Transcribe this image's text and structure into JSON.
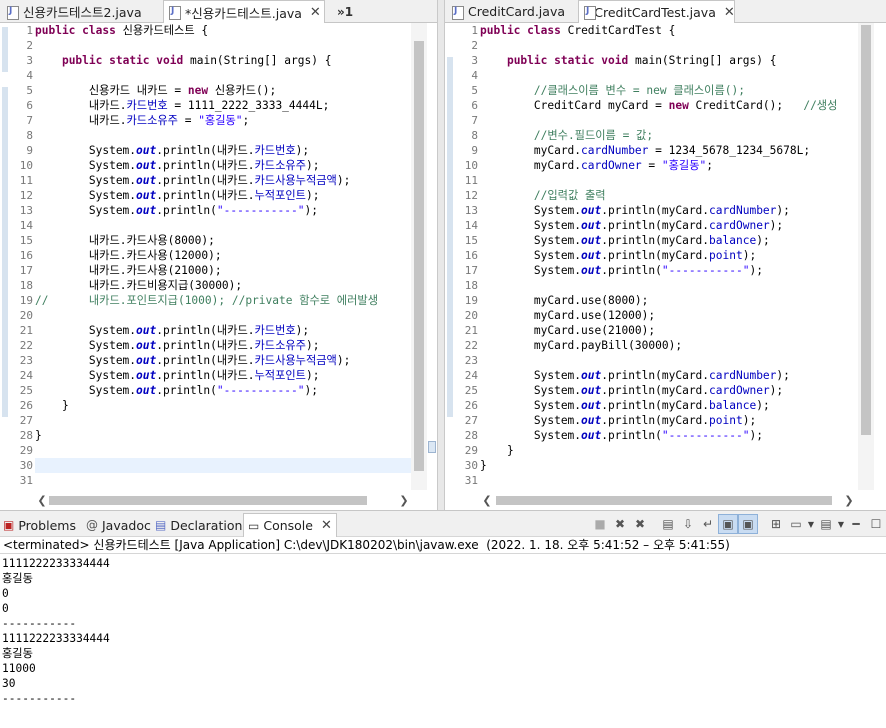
{
  "left_editor": {
    "tabs": [
      {
        "label": "신용카드테스트2.java",
        "active": false
      },
      {
        "label": "*신용카드테스트.java",
        "active": true
      },
      {
        "label": "»1",
        "overflow": true
      }
    ],
    "line_numbers": [
      "1",
      "2",
      "3",
      "4",
      "5",
      "6",
      "7",
      "8",
      "9",
      "10",
      "11",
      "12",
      "13",
      "14",
      "15",
      "16",
      "17",
      "18",
      "19",
      "20",
      "21",
      "22",
      "23",
      "24",
      "25",
      "26",
      "27",
      "28",
      "29",
      "30",
      "31"
    ]
  },
  "right_editor": {
    "tabs": [
      {
        "label": "CreditCard.java",
        "active": false
      },
      {
        "label": "*CreditCardTest.java",
        "active": true
      }
    ],
    "line_numbers": [
      "1",
      "2",
      "3",
      "4",
      "5",
      "6",
      "7",
      "8",
      "9",
      "10",
      "11",
      "12",
      "13",
      "14",
      "15",
      "16",
      "17",
      "18",
      "19",
      "20",
      "21",
      "22",
      "23",
      "24",
      "25",
      "26",
      "27",
      "28",
      "29",
      "30",
      "31"
    ]
  },
  "console": {
    "tabs": [
      {
        "label": "Problems",
        "icon": "problems-icon"
      },
      {
        "label": "Javadoc",
        "icon": "at-icon"
      },
      {
        "label": "Declaration",
        "icon": "declaration-icon"
      },
      {
        "label": "Console",
        "icon": "console-icon",
        "active": true
      }
    ],
    "status": "<terminated> 신용카드테스트 [Java Application] C:\\dev\\JDK180202\\bin\\javaw.exe  (2022. 1. 18. 오후 5:41:52 – 오후 5:41:55)",
    "output": [
      "1111222233334444",
      "홍길동",
      "0",
      "0",
      "-----------",
      "1111222233334444",
      "홍길동",
      "11000",
      "30",
      "-----------"
    ]
  }
}
